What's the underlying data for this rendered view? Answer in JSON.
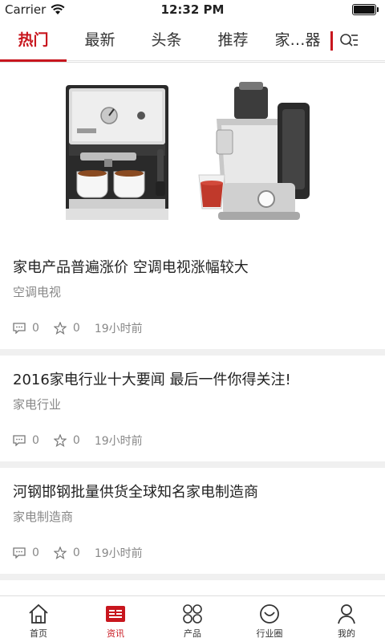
{
  "status": {
    "carrier": "Carrier",
    "time": "12:32 PM",
    "battery_level": 1.0
  },
  "tabs": [
    {
      "label": "热门",
      "active": true
    },
    {
      "label": "最新",
      "active": false
    },
    {
      "label": "头条",
      "active": false
    },
    {
      "label": "推荐",
      "active": false
    },
    {
      "label": "家…器",
      "active": false
    }
  ],
  "colors": {
    "accent": "#c8161e",
    "text": "#222222",
    "muted": "#888888",
    "divider": "#f0f0f0"
  },
  "articles": [
    {
      "title": "家电产品普遍涨价 空调电视涨幅较大",
      "tag": "空调电视",
      "comments": "0",
      "likes": "0",
      "time": "19小时前"
    },
    {
      "title": "2016家电行业十大要闻 最后一件你得关注!",
      "tag": "家电行业",
      "comments": "0",
      "likes": "0",
      "time": "19小时前"
    },
    {
      "title": "河钢邯钢批量供货全球知名家电制造商",
      "tag": "家电制造商",
      "comments": "0",
      "likes": "0",
      "time": "19小时前"
    }
  ],
  "nav": [
    {
      "label": "首页",
      "icon": "home-icon",
      "active": false
    },
    {
      "label": "资讯",
      "icon": "news-icon",
      "active": true
    },
    {
      "label": "产品",
      "icon": "grid-icon",
      "active": false
    },
    {
      "label": "行业圈",
      "icon": "smile-icon",
      "active": false
    },
    {
      "label": "我的",
      "icon": "user-icon",
      "active": false
    }
  ]
}
